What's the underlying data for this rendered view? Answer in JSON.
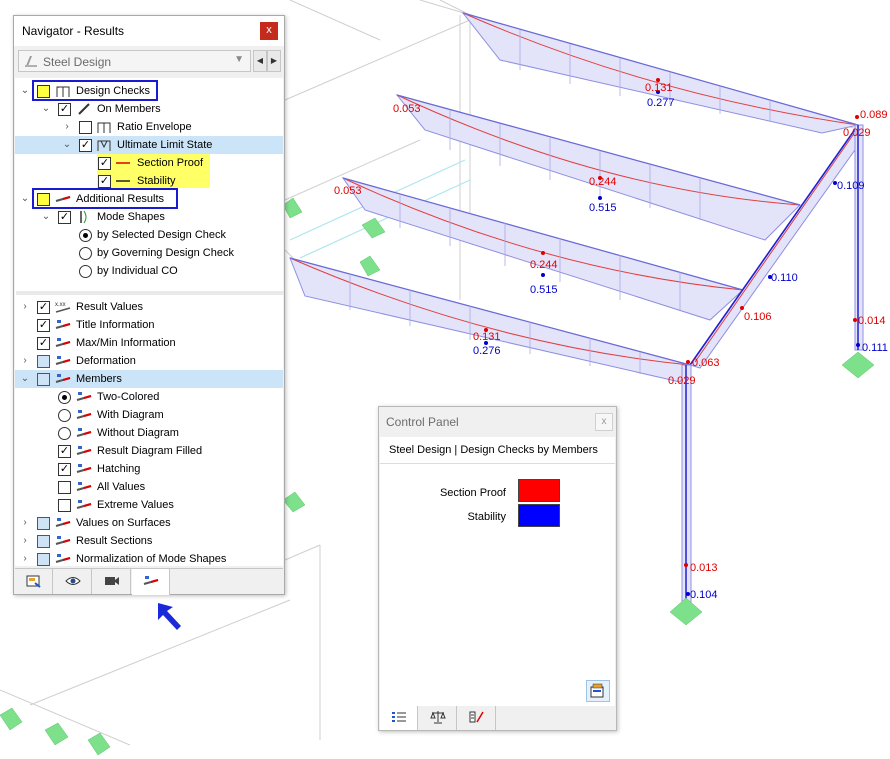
{
  "navigator": {
    "title": "Navigator - Results",
    "close_glyph": "x",
    "dropdown_value": "Steel Design",
    "tree": {
      "design_checks": "Design Checks",
      "on_members": "On Members",
      "ratio_envelope": "Ratio Envelope",
      "ultimate_limit_state": "Ultimate Limit State",
      "section_proof": "Section Proof",
      "stability": "Stability",
      "additional_results": "Additional Results",
      "mode_shapes": "Mode Shapes",
      "by_selected": "by Selected Design Check",
      "by_governing": "by Governing Design Check",
      "by_individual": "by Individual CO",
      "result_values": "Result Values",
      "title_information": "Title Information",
      "max_min_information": "Max/Min Information",
      "deformation": "Deformation",
      "members": "Members",
      "two_colored": "Two-Colored",
      "with_diagram": "With Diagram",
      "without_diagram": "Without Diagram",
      "result_diagram_filled": "Result Diagram Filled",
      "hatching": "Hatching",
      "all_values": "All Values",
      "extreme_values": "Extreme Values",
      "values_on_surfaces": "Values on Surfaces",
      "result_sections": "Result Sections",
      "normalization": "Normalization of Mode Shapes"
    },
    "tabs": [
      "data-icon",
      "eye-icon",
      "camera-icon",
      "results-icon"
    ],
    "active_tab": "results-icon"
  },
  "control_panel": {
    "title": "Control Panel",
    "close_glyph": "x",
    "heading": "Steel Design | Design Checks by Members",
    "legend": [
      {
        "label": "Section Proof",
        "color": "#ff0000"
      },
      {
        "label": "Stability",
        "color": "#0000ff"
      }
    ],
    "tabs": [
      "list-icon",
      "balance-icon",
      "members-icon"
    ],
    "active_tab": "list-icon"
  },
  "model_values": {
    "v1": "0.131",
    "v2": "0.277",
    "v3": "0.053",
    "v4": "0.089",
    "v5": "0.029",
    "v6": "0.244",
    "v7": "0.515",
    "v8": "0.109",
    "v9": "0.053",
    "v10": "0.244",
    "v11": "0.515",
    "v12": "0.110",
    "v13": "0.106",
    "v14": "0.014",
    "v15": "0.111",
    "v16": "0.131",
    "v17": "0.276",
    "v18": "0.029",
    "v19": "0.063",
    "v20": "0.013",
    "v21": "0.104"
  },
  "colors": {
    "section_proof": "#e00000",
    "stability": "#0000cc",
    "highlight_box": "#1a1ad0",
    "highlight_fill": "#ffff66",
    "support": "#7de08a"
  }
}
